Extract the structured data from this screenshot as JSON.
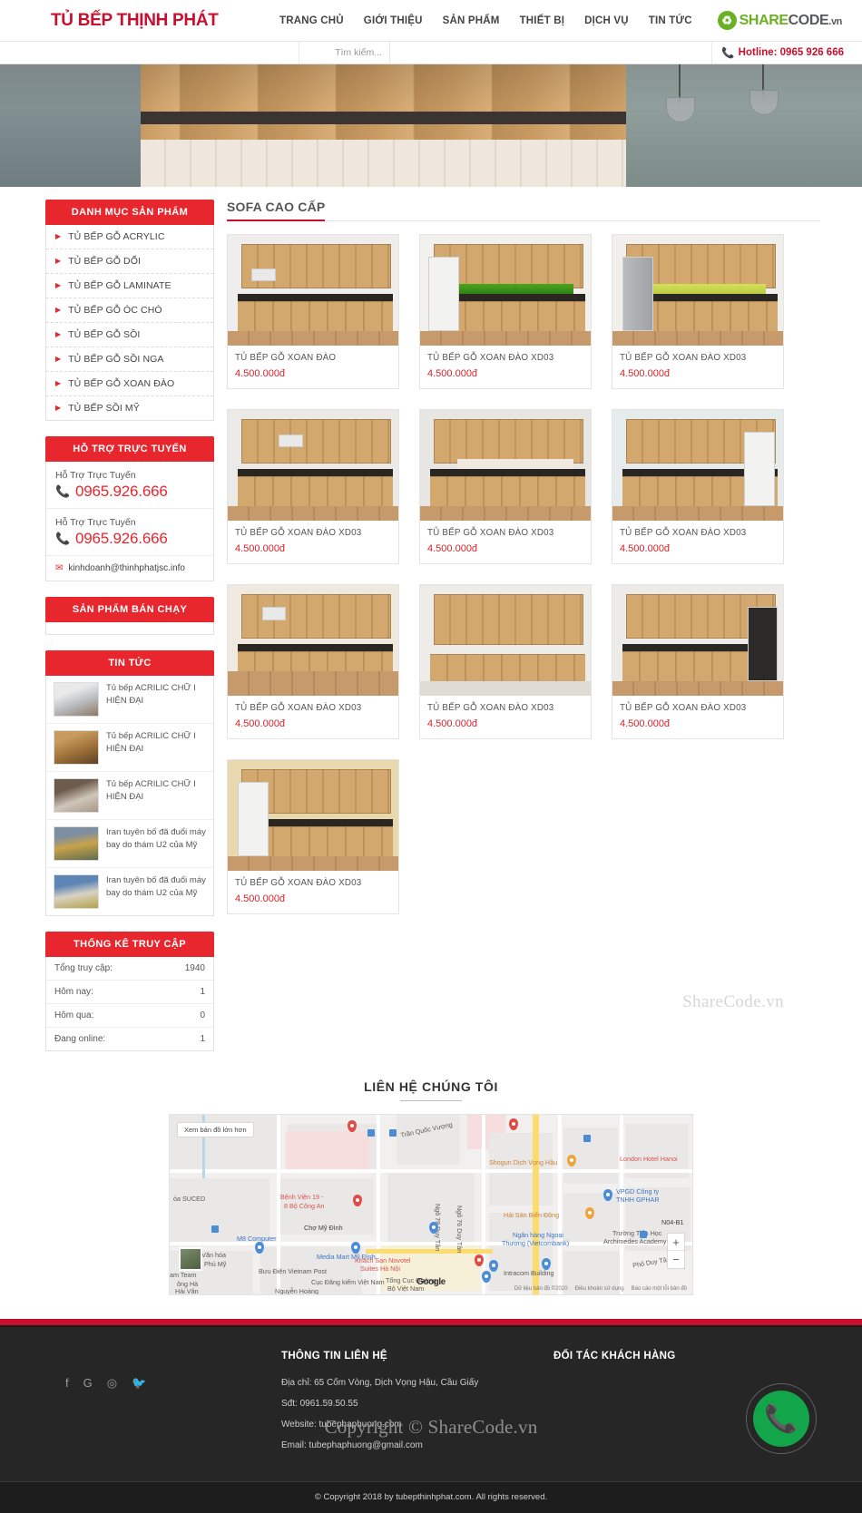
{
  "header": {
    "logo": "TỦ BẾP THỊNH PHÁT",
    "nav": [
      {
        "label": "TRANG CHỦ"
      },
      {
        "label": "GIỚI THIỆU"
      },
      {
        "label": "SẢN PHẨM"
      },
      {
        "label": "THIẾT BỊ"
      },
      {
        "label": "DỊCH VỤ"
      },
      {
        "label": "TIN TỨC"
      }
    ],
    "brand_badge": {
      "icon": "recycle-icon",
      "part1": "SHARE",
      "part2": "CODE",
      "part3": ".vn"
    },
    "search_placeholder": "Tìm kiếm...",
    "hotline": "Hotline: 0965 926 666",
    "phone_icon": "phone-icon"
  },
  "sidebar": {
    "categories": {
      "title": "DANH MỤC SẢN PHẨM",
      "items": [
        {
          "label": "TỦ BẾP GỖ ACRYLIC"
        },
        {
          "label": "TỦ BẾP GỖ DỔI"
        },
        {
          "label": "TỦ BẾP GỖ LAMINATE"
        },
        {
          "label": "TỦ BẾP GỖ ÓC CHÓ"
        },
        {
          "label": "TỦ BẾP GỖ SỒI"
        },
        {
          "label": "TỦ BẾP GỖ SỒI NGA"
        },
        {
          "label": "TỦ BẾP GỖ XOAN ĐÀO"
        },
        {
          "label": "TỦ BẾP SỒI MỸ"
        }
      ]
    },
    "support": {
      "title": "HỖ TRỢ TRỰC TUYẾN",
      "contacts": [
        {
          "label": "Hỗ Trợ Trực Tuyến",
          "phone": "0965.926.666"
        },
        {
          "label": "Hỗ Trợ Trực Tuyến",
          "phone": "0965.926.666"
        }
      ],
      "email": "kinhdoanh@thinhphatjsc.info"
    },
    "bestseller": {
      "title": "SẢN PHẨM BÁN CHẠY"
    },
    "news": {
      "title": "TIN TỨC",
      "items": [
        {
          "title": "Tủ bếp ACRILIC CHỮ I HIỆN ĐẠI"
        },
        {
          "title": "Tủ bếp ACRILIC CHỮ I HIỆN ĐẠI"
        },
        {
          "title": "Tủ bếp ACRILIC CHỮ I HIỆN ĐẠI"
        },
        {
          "title": "Iran tuyên bố đã đuổi máy bay do thám U2 của Mỹ"
        },
        {
          "title": "Iran tuyên bố đã đuổi máy bay do thám U2 của Mỹ"
        }
      ]
    },
    "stats": {
      "title": "THỐNG KÊ TRUY CẬP",
      "rows": [
        {
          "label": "Tổng truy cập:",
          "value": "1940"
        },
        {
          "label": "Hôm nay:",
          "value": "1"
        },
        {
          "label": "Hôm qua:",
          "value": "0"
        },
        {
          "label": "Đang online:",
          "value": "1"
        }
      ]
    }
  },
  "main": {
    "section_title": "SOFA CAO CẤP",
    "watermark": "ShareCode.vn",
    "products": [
      {
        "name": "TỦ BẾP GỖ XOAN ĐÀO",
        "price": "4.500.000đ"
      },
      {
        "name": "TỦ BẾP GỖ XOAN ĐÀO XD03",
        "price": "4.500.000đ"
      },
      {
        "name": "TỦ BẾP GỖ XOAN ĐÀO XD03",
        "price": "4.500.000đ"
      },
      {
        "name": "TỦ BẾP GỖ XOAN ĐÀO XD03",
        "price": "4.500.000đ"
      },
      {
        "name": "TỦ BẾP GỖ XOAN ĐÀO XD03",
        "price": "4.500.000đ"
      },
      {
        "name": "TỦ BẾP GỖ XOAN ĐÀO XD03",
        "price": "4.500.000đ"
      },
      {
        "name": "TỦ BẾP GỖ XOAN ĐÀO XD03",
        "price": "4.500.000đ"
      },
      {
        "name": "TỦ BẾP GỖ XOAN ĐÀO XD03",
        "price": "4.500.000đ"
      },
      {
        "name": "TỦ BẾP GỖ XOAN ĐÀO XD03",
        "price": "4.500.000đ"
      },
      {
        "name": "TỦ BẾP GỖ XOAN ĐÀO XD03",
        "price": "4.500.000đ"
      }
    ]
  },
  "contact": {
    "title": "LIÊN HỆ CHÚNG TÔI",
    "map": {
      "expand_label": "Xem bản đồ lớn hơn",
      "zoom_in": "+",
      "zoom_out": "−",
      "brand": "Google",
      "labels": [
        {
          "text": "òa SUCED"
        },
        {
          "text": "Bệnh Viện 19 -"
        },
        {
          "text": "8 Bộ Công An"
        },
        {
          "text": "Chợ Mỹ Đình"
        },
        {
          "text": "M8 Computer"
        },
        {
          "text": "Media Mart Mỹ Đình"
        },
        {
          "text": "Nhà Văn hóa"
        },
        {
          "text": "thôn Phú Mỹ"
        },
        {
          "text": "am Team"
        },
        {
          "text": "ông Hà"
        },
        {
          "text": "Hải Vân"
        },
        {
          "text": "Nguyễn Hoàng"
        },
        {
          "text": "Bưu Điện Vietnam Post"
        },
        {
          "text": "Cục Đăng kiểm Việt Nam"
        },
        {
          "text": "Trần Quốc Vượng"
        },
        {
          "text": "Shogun Dịch Vọng Hậu"
        },
        {
          "text": "Hải Sản Biển Đông"
        },
        {
          "text": "Ngân hàng Ngoại"
        },
        {
          "text": "Thương (Vietcombank)"
        },
        {
          "text": "Khách Sạn Novotel"
        },
        {
          "text": "Suites Hà Nội"
        },
        {
          "text": "Intracom Building"
        },
        {
          "text": "Tổng Cục Đường"
        },
        {
          "text": "Bộ Việt Nam"
        },
        {
          "text": "London Hotel Hanoi"
        },
        {
          "text": "VPGD Công ty"
        },
        {
          "text": "TNHH GPHAR"
        },
        {
          "text": "Trường Tiểu Học"
        },
        {
          "text": "Archimedes Academy"
        },
        {
          "text": "N04-B1"
        },
        {
          "text": "Phố Duy Tân"
        },
        {
          "text": "Ngõ 78 Duy Tân"
        },
        {
          "text": "Ngõ 76 Duy Tân"
        }
      ],
      "attribution": [
        "Dữ liệu bản đồ ©2020",
        "Điều khoản sử dụng",
        "Báo cáo một lỗi bản đồ"
      ]
    }
  },
  "footer": {
    "social": [
      {
        "icon": "facebook-icon",
        "glyph": "f"
      },
      {
        "icon": "google-icon",
        "glyph": "G"
      },
      {
        "icon": "instagram-icon",
        "glyph": "◎"
      },
      {
        "icon": "twitter-icon",
        "glyph": "🐦"
      }
    ],
    "contact_heading": "THÔNG TIN LIÊN HỆ",
    "partner_heading": "ĐỐI TÁC KHÁCH HÀNG",
    "lines": [
      "Địa chỉ: 65 Cốm Vòng, Dịch Vọng Hậu, Cầu Giấy",
      "Sđt: 0961.59.50.55",
      "Website: tubephaphuong.com",
      "Email: tubephaphuong@gmail.com"
    ],
    "watermark": "Copyright © ShareCode.vn",
    "copyright": "© Copyright 2018 by tubepthinhphat.com. All rights reserved.",
    "call_icon": "phone-call-icon"
  },
  "colors": {
    "brand_red": "#c8102e",
    "panel_red": "#e8262d",
    "price_red": "#d6232a",
    "green": "#13a54a"
  }
}
